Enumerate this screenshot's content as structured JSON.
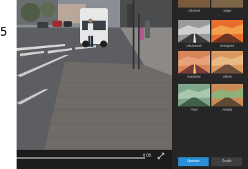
{
  "left_glyph": "5",
  "player": {
    "time": "0:06",
    "progress": 1.0
  },
  "filters": [
    {
      "label": "Ožívené",
      "style": "vivid"
    },
    {
      "label": "Sépie",
      "style": "sepia"
    },
    {
      "label": "Inkoustové",
      "style": "ink"
    },
    {
      "label": "Energické",
      "style": "energetic"
    },
    {
      "label": "Radostné",
      "style": "joyful"
    },
    {
      "label": "Větrné",
      "style": "windy"
    },
    {
      "label": "Pixel",
      "style": "pixel"
    },
    {
      "label": "Arkáda",
      "style": "arcade"
    }
  ],
  "buttons": {
    "done": "Hotovo",
    "cancel": "Zrušit"
  },
  "colors": {
    "accent": "#2b8fd6",
    "panel_bg": "#262626",
    "player_bg": "#1c1c1c"
  }
}
